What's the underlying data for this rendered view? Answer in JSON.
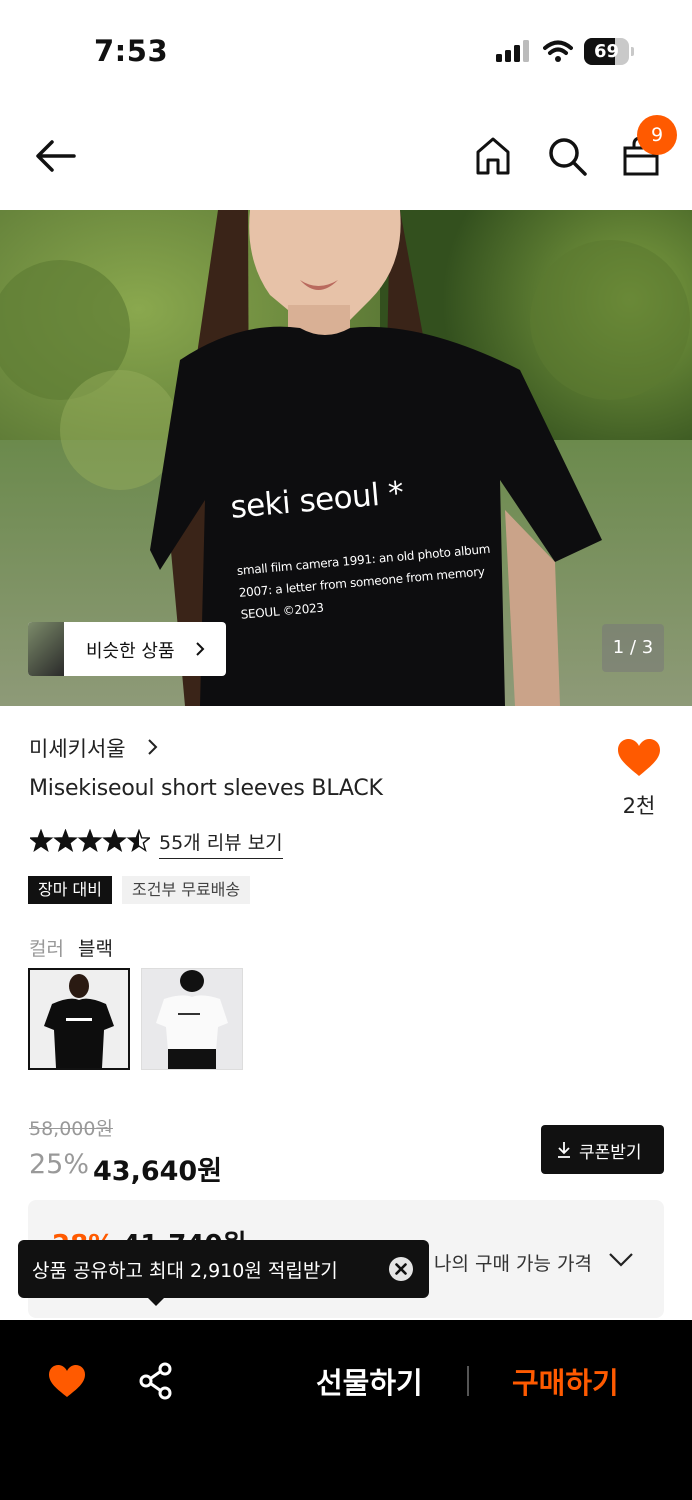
{
  "status_bar": {
    "time": "7:53",
    "battery": "69",
    "battery_level": 0.69
  },
  "header": {
    "cart_count": "9",
    "icons": [
      "back-arrow-icon",
      "home-icon",
      "search-icon",
      "shopping-bag-icon"
    ]
  },
  "hero": {
    "shirt_print_title": "seki seoul *",
    "shirt_print_lines": [
      "small film camera 1991: an old photo album",
      "2007: a letter from someone from memory",
      "SEOUL ©2023"
    ],
    "similar_label": "비슷한 상품",
    "pager": "1 / 3"
  },
  "product": {
    "brand": "미세키서울",
    "title": "Misekiseoul short sleeves BLACK",
    "like_count": "2천",
    "rating_stars": 4.5,
    "reviews_label": "55개 리뷰 보기",
    "tags": [
      "장마 대비",
      "조건부 무료배송"
    ],
    "color_label": "컬러",
    "color_value": "블랙",
    "original_price": "58,000원",
    "discount": "25%",
    "price": "43,640원",
    "coupon_label": "쿠폰받기",
    "my_price_peek_discount": "28%",
    "my_price_peek_value": "41,740원",
    "my_price_label": "나의 구매 가능 가격"
  },
  "tooltip": {
    "text": "상품 공유하고 최대 2,910원 적립받기"
  },
  "bottom_bar": {
    "gift_label": "선물하기",
    "buy_label": "구매하기"
  },
  "colors": {
    "accent": "#ff5a00",
    "dark": "#111111"
  }
}
